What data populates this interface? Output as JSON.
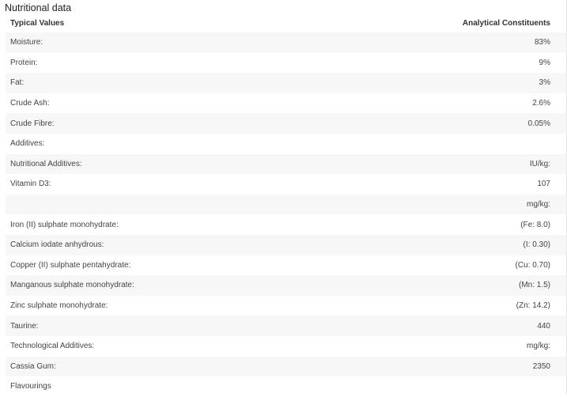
{
  "section": {
    "title": "Nutritional data"
  },
  "table": {
    "headers": {
      "left": "Typical Values",
      "right": "Analytical Constituents"
    },
    "rows": [
      {
        "label": "Moisture:",
        "value": "83%"
      },
      {
        "label": "Protein:",
        "value": "9%"
      },
      {
        "label": "Fat:",
        "value": "3%"
      },
      {
        "label": "Crude Ash:",
        "value": "2.6%"
      },
      {
        "label": "Crude Fibre:",
        "value": "0.05%"
      },
      {
        "label": "Additives:",
        "value": ""
      },
      {
        "label": "Nutritional Additives:",
        "value": "IU/kg:"
      },
      {
        "label": "Vitamin D3:",
        "value": "107"
      },
      {
        "label": "",
        "value": "mg/kg:"
      },
      {
        "label": "Iron (II) sulphate monohydrate:",
        "value": "(Fe: 8.0)"
      },
      {
        "label": "Calcium iodate anhydrous:",
        "value": "(I: 0.30)"
      },
      {
        "label": "Copper (II) sulphate pentahydrate:",
        "value": "(Cu: 0.70)"
      },
      {
        "label": "Manganous sulphate monohydrate:",
        "value": "(Mn: 1.5)"
      },
      {
        "label": "Zinc sulphate monohydrate:",
        "value": "(Zn: 14.2)"
      },
      {
        "label": "Taurine:",
        "value": "440"
      },
      {
        "label": "Technological Additives:",
        "value": "mg/kg:"
      },
      {
        "label": "Cassia Gum:",
        "value": "2350"
      },
      {
        "label": "Flavourings",
        "value": ""
      }
    ]
  }
}
